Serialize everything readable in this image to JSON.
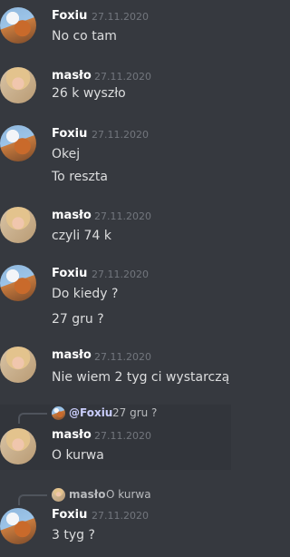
{
  "messages": [
    {
      "author": "Foxiu",
      "time": "27.11.2020",
      "lines": [
        "No co tam"
      ]
    },
    {
      "author": "masło",
      "time": "27.11.2020",
      "lines": [
        "26 k wyszło"
      ]
    },
    {
      "author": "Foxiu",
      "time": "27.11.2020",
      "lines": [
        "Okej",
        "To reszta"
      ]
    },
    {
      "author": "masło",
      "time": "27.11.2020",
      "lines": [
        "czyli 74 k"
      ]
    },
    {
      "author": "Foxiu",
      "time": "27.11.2020",
      "lines": [
        "Do kiedy ?",
        "27 gru ?"
      ]
    },
    {
      "author": "masło",
      "time": "27.11.2020",
      "lines": [
        "Nie wiem 2 tyg ci wystarczą"
      ]
    },
    {
      "author": "masło",
      "time": "27.11.2020",
      "lines": [
        "O kurwa"
      ],
      "reply_to": {
        "author": "@Foxiu",
        "text": "27 gru ?"
      }
    },
    {
      "author": "Foxiu",
      "time": "27.11.2020",
      "lines": [
        "3 tyg ?"
      ],
      "reply_to": {
        "author": "masło",
        "text": "O kurwa"
      }
    }
  ]
}
